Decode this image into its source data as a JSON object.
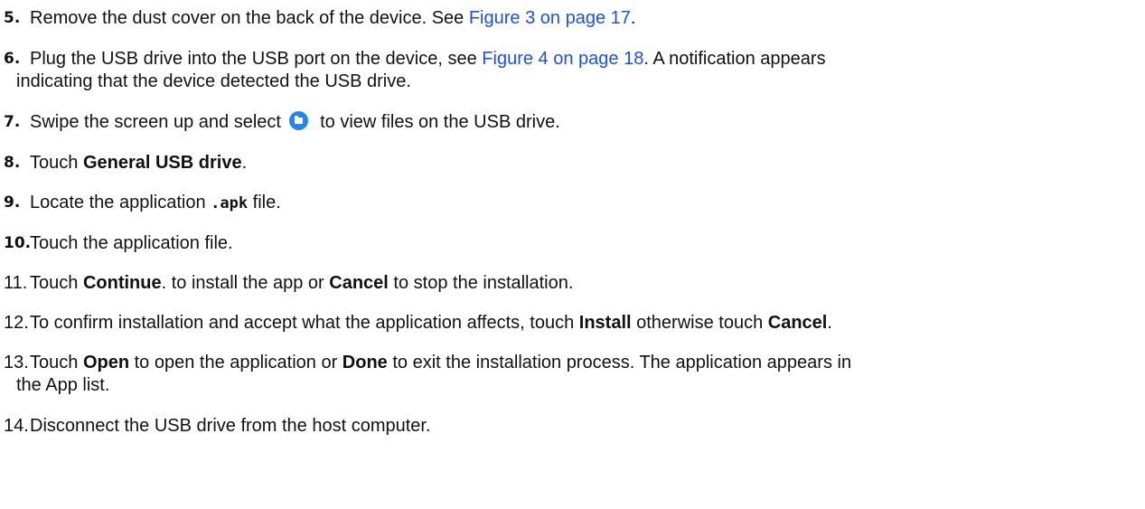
{
  "steps": [
    {
      "num": "5.",
      "parts": [
        "Remove the dust cover on the back of the device. See ",
        "Figure 3 on page 17",
        "."
      ]
    },
    {
      "num": "6.",
      "parts": [
        "Plug the USB drive into the USB port on the device, see ",
        "Figure 4 on page 18",
        ". A notification appears"
      ],
      "line2": "indicating that the device detected the USB drive."
    },
    {
      "num": "7.",
      "parts": [
        "Swipe the screen up and select",
        "to view files on the USB drive."
      ],
      "icon": "folder-icon"
    },
    {
      "num": "8.",
      "parts": [
        "Touch ",
        "General USB drive",
        "."
      ]
    },
    {
      "num": "9.",
      "parts": [
        "Locate the application ",
        ".apk",
        " file."
      ]
    },
    {
      "num": "10.",
      "parts": [
        "Touch the application file."
      ]
    },
    {
      "num": "11.",
      "parts": [
        "Touch ",
        "Continue",
        ". to install the app or ",
        "Cancel",
        " to stop the installation."
      ]
    },
    {
      "num": "12.",
      "parts": [
        "To confirm installation and accept what the application affects, touch ",
        "Install",
        " otherwise touch ",
        "Cancel",
        "."
      ]
    },
    {
      "num": "13.",
      "parts": [
        "Touch ",
        "Open",
        " to open the application or ",
        "Done",
        " to exit the installation process. The application appears in"
      ],
      "line2": "the App list."
    },
    {
      "num": "14.",
      "parts": [
        "Disconnect the USB drive from the host computer."
      ]
    }
  ],
  "colors": {
    "link": "#1a52e8",
    "icon": "#1e86f0",
    "text": "#111111"
  }
}
